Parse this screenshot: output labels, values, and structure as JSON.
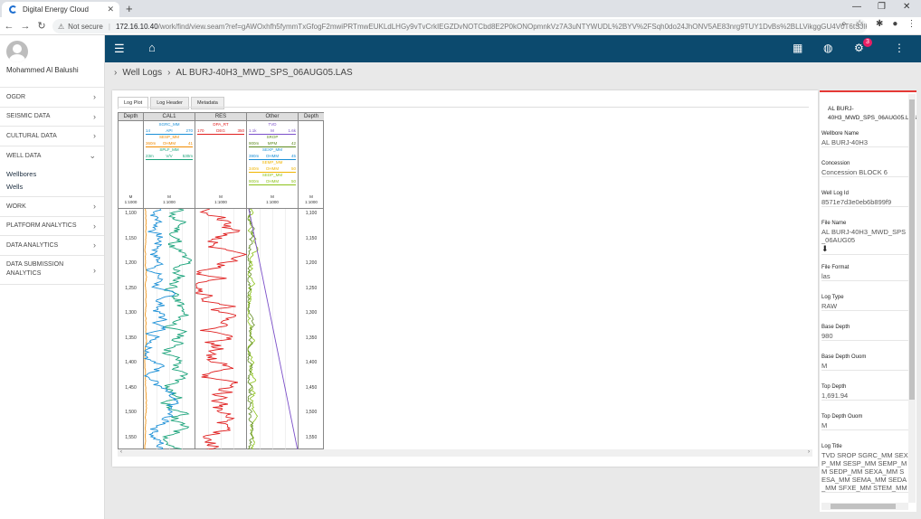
{
  "browser": {
    "tab_title": "Digital Energy Cloud",
    "not_secure": "Not secure",
    "url_host": "172.16.10.40",
    "url_path": "/work/find/view.seam?ref=gAWOxhfh5fymmTxGfogF2mwiPRTmwEUKLdLHGy9vTvCrkIEGZDvNOTCbd8E2P0kONOpmnkVz7A3uNTYWUDL%2BYV%2FSqh0do24JhONV5AE83nrg9TUY1DvBs%2BLLVikggGU4V0T6tSJlKogDmR3cNA68IQ..."
  },
  "user": {
    "name": "Mohammed Al Balushi"
  },
  "sidebar": {
    "items": [
      {
        "label": "OGDR"
      },
      {
        "label": "SEISMIC DATA"
      },
      {
        "label": "CULTURAL DATA"
      },
      {
        "label": "WELL DATA"
      },
      {
        "label": "WORK"
      },
      {
        "label": "PLATFORM ANALYTICS"
      },
      {
        "label": "DATA ANALYTICS"
      },
      {
        "label": "DATA SUBMISSION ANALYTICS"
      }
    ],
    "well_sub": [
      "Wellbores",
      "Wells"
    ]
  },
  "header": {
    "notification_count": "3"
  },
  "breadcrumb": {
    "section": "Well Logs",
    "current": "AL BURJ-40H3_MWD_SPS_06AUG05.LAS"
  },
  "tabs": [
    "Log Plot",
    "Log Header",
    "Metadata"
  ],
  "log_plot": {
    "tracks": [
      "Depth",
      "CAL1",
      "RES",
      "Other",
      "Depth"
    ],
    "legends": {
      "cal1": [
        {
          "name": "SGRC_MM",
          "min": "14",
          "unit": "API",
          "max": "270",
          "color": "#1a8fd6"
        },
        {
          "name": "SESP_MM",
          "min": "360m",
          "unit": "OHMM",
          "max": "41",
          "color": "#f08a00"
        },
        {
          "name": "SPLF_MM",
          "min": "23m",
          "unit": "V/V",
          "max": "530m",
          "color": "#1aa37a"
        }
      ],
      "res": [
        {
          "name": "DPA_RT",
          "min": "170",
          "unit": "DEG",
          "max": "350",
          "color": "#e02020"
        }
      ],
      "other": [
        {
          "name": "TVD",
          "min": "1.1k",
          "unit": "M",
          "max": "1.6k",
          "color": "#7b4fc9"
        },
        {
          "name": "SROP",
          "min": "900m",
          "unit": "MPM",
          "max": "42",
          "color": "#5e8a1e"
        },
        {
          "name": "SEXP_MM",
          "min": "390m",
          "unit": "OHMM",
          "max": "45",
          "color": "#1a8fd6"
        },
        {
          "name": "SEMP_MM",
          "min": "340m",
          "unit": "OHMM",
          "max": "50",
          "color": "#f0b400"
        },
        {
          "name": "SEDP_MM",
          "min": "900m",
          "unit": "OHMM",
          "max": "50",
          "color": "#8cc21a"
        }
      ]
    },
    "scale_unit": "M",
    "scale_ratio": "1:1000",
    "depth_ticks": [
      "1,100",
      "1,150",
      "1,200",
      "1,250",
      "1,300",
      "1,350",
      "1,400",
      "1,450",
      "1,500",
      "1,550"
    ]
  },
  "metadata": {
    "title": "AL BURJ-40H3_MWD_SPS_06AUG05.LAS",
    "fields": [
      {
        "label": "Wellbore Name",
        "value": "AL BURJ-40H3"
      },
      {
        "label": "Concession",
        "value": "Concession BLOCK 6"
      },
      {
        "label": "Well Log Id",
        "value": "8571e7d3e0eb6b899f9"
      },
      {
        "label": "File Name",
        "value": "AL BURJ-40H3_MWD_SPS_06AUG05"
      },
      {
        "label": "File Format",
        "value": "las"
      },
      {
        "label": "Log Type",
        "value": "RAW"
      },
      {
        "label": "Base Depth",
        "value": "980"
      },
      {
        "label": "Base Depth Ouom",
        "value": "M"
      },
      {
        "label": "Top Depth",
        "value": "1,691.94"
      },
      {
        "label": "Top Depth Ouom",
        "value": "M"
      },
      {
        "label": "Log Title",
        "value": "TVD SROP SGRC_MM SEXP_MM SESP_MM SEMP_MM SEDP_MM SEXA_MM SESA_MM SEMA_MM SEDA_MM SFXE_MM STEM_MM"
      }
    ]
  }
}
